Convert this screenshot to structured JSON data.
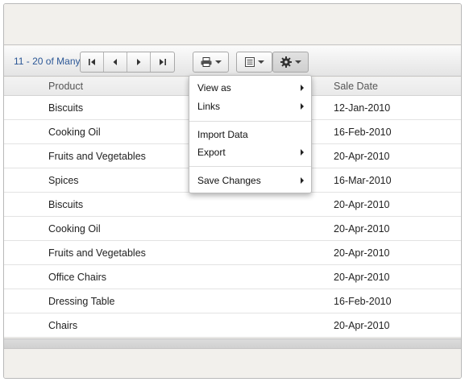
{
  "toolbar": {
    "pager_label": "11 - 20 of Many",
    "pager_buttons": [
      "first-page",
      "previous-page",
      "next-page",
      "last-page"
    ]
  },
  "grid": {
    "columns": [
      "Product",
      "Sale Date"
    ],
    "rows": [
      {
        "product": "Biscuits",
        "sale_date": "12-Jan-2010"
      },
      {
        "product": "Cooking Oil",
        "sale_date": "16-Feb-2010"
      },
      {
        "product": "Fruits and Vegetables",
        "sale_date": "20-Apr-2010"
      },
      {
        "product": "Spices",
        "sale_date": "16-Mar-2010"
      },
      {
        "product": "Biscuits",
        "sale_date": "20-Apr-2010"
      },
      {
        "product": "Cooking Oil",
        "sale_date": "20-Apr-2010"
      },
      {
        "product": "Fruits and Vegetables",
        "sale_date": "20-Apr-2010"
      },
      {
        "product": "Office Chairs",
        "sale_date": "20-Apr-2010"
      },
      {
        "product": "Dressing Table",
        "sale_date": "16-Feb-2010"
      },
      {
        "product": "Chairs",
        "sale_date": "20-Apr-2010"
      }
    ]
  },
  "menu": {
    "items": [
      {
        "label": "View as",
        "submenu": true
      },
      {
        "label": "Links",
        "submenu": true
      },
      {
        "label": "Import Data",
        "submenu": false
      },
      {
        "label": "Export",
        "submenu": true
      },
      {
        "label": "Save Changes",
        "submenu": true
      }
    ]
  },
  "colors": {
    "pager_text": "#2b5796",
    "frame_bg": "#f2f0ec"
  }
}
